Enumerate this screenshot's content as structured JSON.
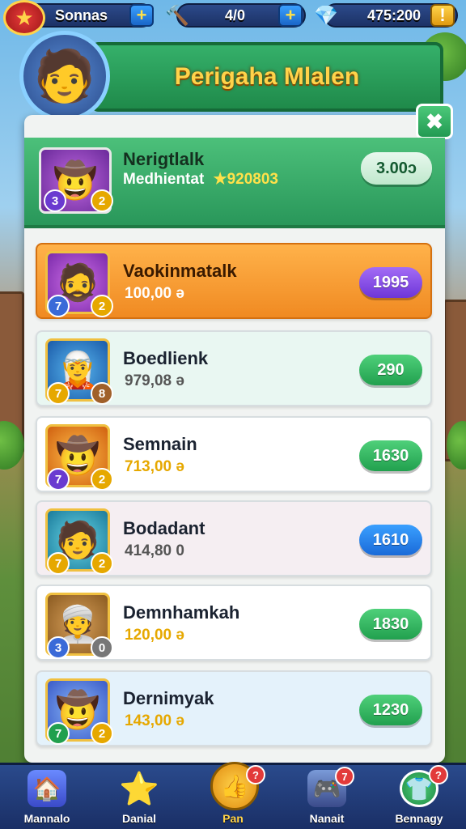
{
  "topbar": {
    "player_name": "Sonnas",
    "energy": "4/0",
    "coins": "475:200"
  },
  "header": {
    "title": "Perigaha Mlalen"
  },
  "my_entry": {
    "name": "Nerigtlalk",
    "subtitle": "Medhientat",
    "score": "★920803",
    "badge_left": "3",
    "badge_right": "2",
    "points": "3.00ɔ"
  },
  "leaderboard": [
    {
      "name": "Vaokinmatalk",
      "score": "100,00 ə",
      "left": "7",
      "right": "2",
      "points": "1995"
    },
    {
      "name": "Boedlienk",
      "score": "979,08 ə",
      "left": "7",
      "right": "8",
      "points": "290"
    },
    {
      "name": "Semnain",
      "score": "713,00 ə",
      "left": "7",
      "right": "2",
      "points": "1630"
    },
    {
      "name": "Bodadant",
      "score": "414,80 0",
      "left": "7",
      "right": "2",
      "points": "1610"
    },
    {
      "name": "Demnhamkah",
      "score": "120,00 ə",
      "left": "3",
      "right": "0",
      "points": "1830"
    },
    {
      "name": "Dernimyak",
      "score": "143,00 ə",
      "left": "7",
      "right": "2",
      "points": "1230"
    }
  ],
  "nav": [
    {
      "label": "Mannalo",
      "icon": "home-icon",
      "badge": ""
    },
    {
      "label": "Danial",
      "icon": "star-icon",
      "badge": ""
    },
    {
      "label": "Pan",
      "icon": "thumb-icon",
      "badge": "?"
    },
    {
      "label": "Nanait",
      "icon": "gamepad-icon",
      "badge": "7"
    },
    {
      "label": "Bennagy",
      "icon": "shirt-icon",
      "badge": "?"
    }
  ],
  "colors": {
    "header_green": "#29975a",
    "title_gold": "#ffd34a",
    "nav_blue": "#1a2f66",
    "highlight_orange": "#f08a22"
  }
}
